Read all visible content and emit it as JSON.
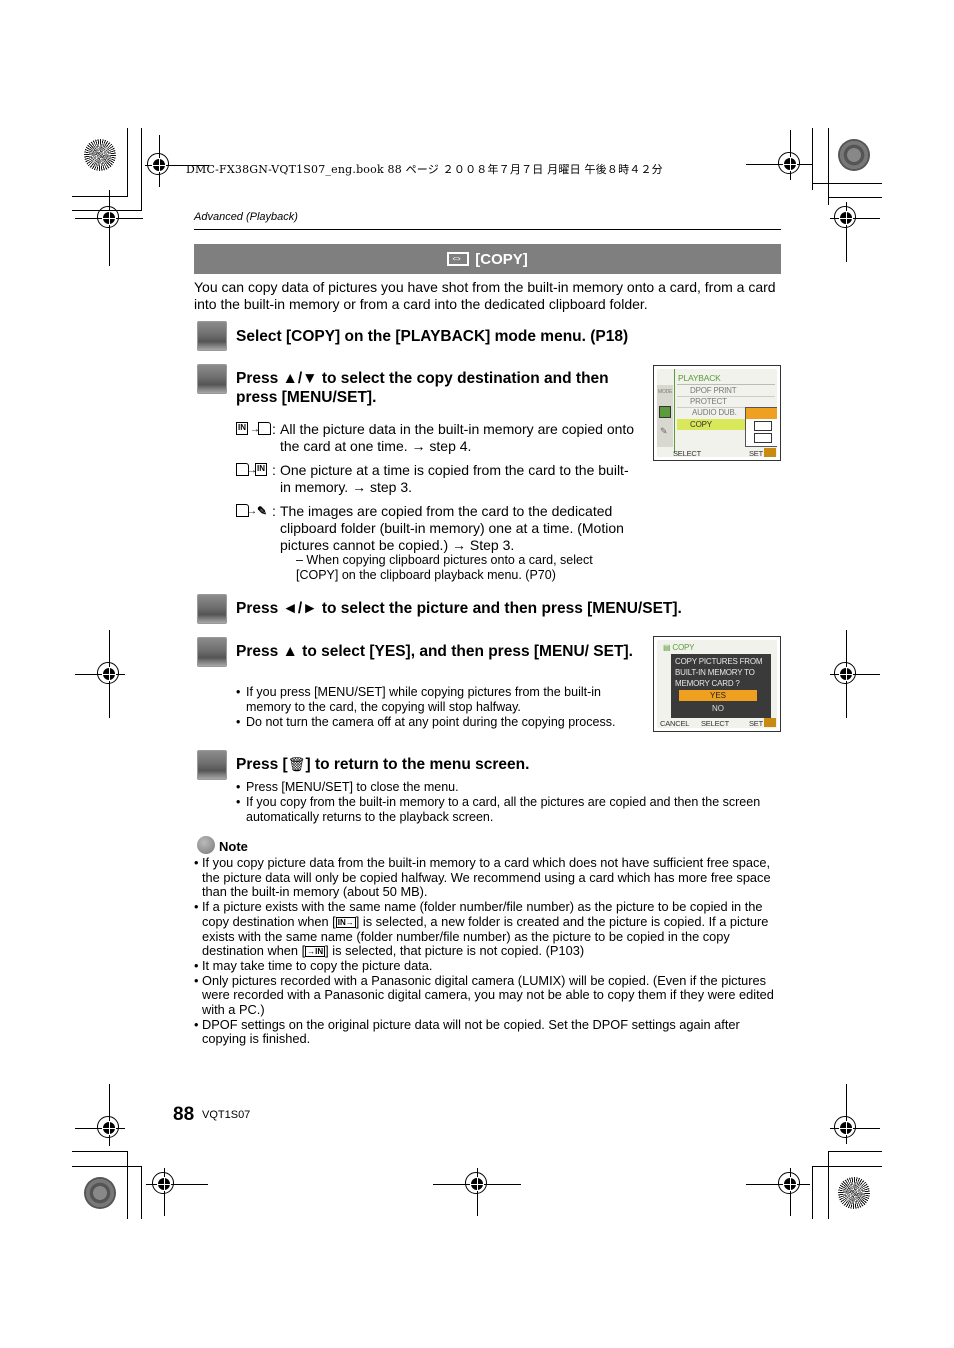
{
  "print_header": "DMC-FX38GN-VQT1S07_eng.book  88 ページ  ２００８年７月７日  月曜日  午後８時４２分",
  "section_label": "Advanced (Playback)",
  "title": {
    "icon": "copy-icon",
    "text": "[COPY]"
  },
  "intro": "You can copy data of pictures you have shot from the built-in memory onto a card, from a card into the built-in memory or from a card into the dedicated clipboard folder.",
  "steps": [
    {
      "text": "Select [COPY] on the [PLAYBACK] mode menu. (P18)"
    },
    {
      "text": "Press ▲/▼ to select the copy destination and then press [MENU/SET].",
      "options": [
        {
          "icon": "internal-to-card-icon",
          "desc": "All the picture data in the built-in memory are copied onto the card at one time. → step 4."
        },
        {
          "icon": "card-to-internal-icon",
          "desc": "One picture at a time is copied from the card to the built-in memory. → step 3."
        },
        {
          "icon": "card-to-clipboard-icon",
          "desc": "The images are copied from the card to the dedicated clipboard folder (built-in memory) one at a time. (Motion pictures cannot be copied.) → Step 3."
        }
      ],
      "sub_note": "– When copying clipboard pictures onto a card, select [COPY] on the clipboard playback menu. (P70)"
    },
    {
      "text": "Press ◄/► to select the picture and then press [MENU/SET]."
    },
    {
      "text": "Press ▲ to select [YES], and then press [MENU/ SET].",
      "bullets": [
        "If you press [MENU/SET] while copying pictures from the built-in memory to the card, the copying will stop halfway.",
        "Do not turn the camera off at any point during the copying process."
      ]
    },
    {
      "text_before": "Press [",
      "text_icon": "trash-icon",
      "text_after": "] to return to the menu screen.",
      "bullets": [
        "Press [MENU/SET] to close the menu.",
        "If you copy from the built-in memory to a card, all the pictures are copied and then the screen automatically returns to the playback screen."
      ]
    }
  ],
  "screen1": {
    "header": "PLAYBACK",
    "side_tab": "MODE",
    "items": [
      "DPOF PRINT",
      "PROTECT",
      "AUDIO DUB.",
      "COPY"
    ],
    "selected_item": "COPY",
    "footer_left": "SELECT",
    "footer_right": "SET",
    "submenu_selected_index": 0
  },
  "screen2": {
    "header": "COPY",
    "message": [
      "COPY PICTURES FROM",
      "BUILT-IN MEMORY TO",
      "MEMORY CARD ?"
    ],
    "options": [
      "YES",
      "NO"
    ],
    "selected_option": "YES",
    "footer_cancel": "CANCEL",
    "footer_select": "SELECT",
    "footer_set": "SET"
  },
  "note": {
    "label": "Note",
    "items": [
      "If you copy picture data from the built-in memory to a card which does not have sufficient free space, the picture data will only be copied halfway. We recommend using a card which has more free space than the built-in memory (about 50 MB).",
      {
        "before": "If a picture exists with the same name (folder number/file number) as the picture to be copied in the copy destination when [",
        "icon1": "IN→",
        "middle": "] is selected, a new folder is created and the picture is copied. If a picture exists with the same name (folder number/file number) as the picture to be copied in the copy destination when [",
        "icon2": "→IN",
        "after": "] is selected, that picture is not copied. (P103)"
      },
      "It may take time to copy the picture data.",
      "Only pictures recorded with a Panasonic digital camera (LUMIX) will be copied. (Even if the pictures were recorded with a Panasonic digital camera, you may not be able to copy them if they were edited with a PC.)",
      "DPOF settings on the original picture data will not be copied. Set the DPOF settings again after copying is finished."
    ]
  },
  "footer": {
    "page_number": "88",
    "doc_code": "VQT1S07"
  },
  "colors": {
    "title_bar": "#7f7f7f",
    "menu_highlight": "#d8e85a",
    "orange_select": "#f0a020",
    "menu_green": "#5a9b3a"
  }
}
